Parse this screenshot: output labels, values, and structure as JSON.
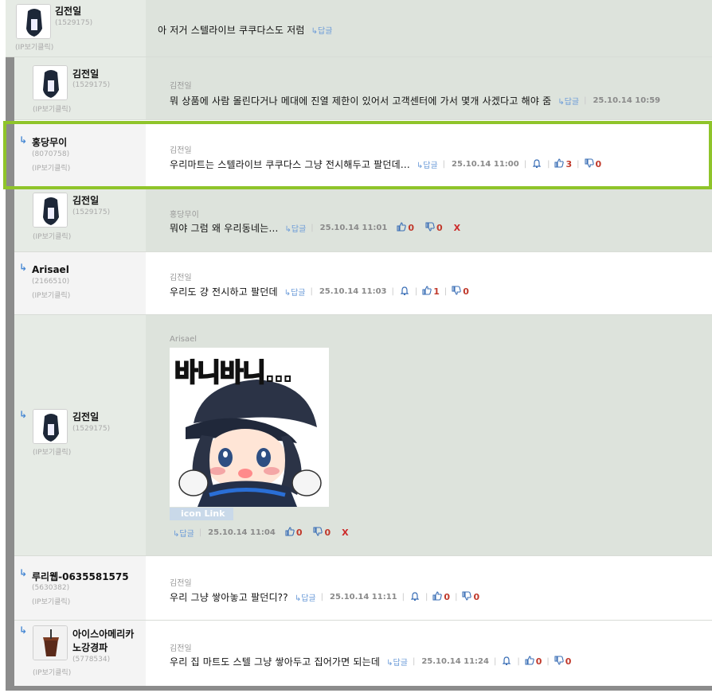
{
  "comments": [
    {
      "nick": "김전일",
      "uid": "(1529175)",
      "ip": "(IP보기클릭)",
      "text": "아 저거 스텔라이브 쿠쿠다스도 저럼",
      "reply_label": "↳답글"
    },
    {
      "nick": "김전일",
      "uid": "(1529175)",
      "ip": "(IP보기클릭)",
      "target": "김전일",
      "text": "뭐 상품에 사람 몰린다거나 메대에 진열 제한이 있어서 고객센터에 가서 몇개 사겠다고 해야 줌",
      "reply_label": "↳답글",
      "date": "25.10.14 10:59"
    },
    {
      "nick": "홍당무이",
      "uid": "(8070758)",
      "ip": "(IP보기클릭)",
      "target": "김전일",
      "text": "우리마트는 스텔라이브 쿠쿠다스 그냥 전시해두고 팔던데...",
      "reply_label": "↳답글",
      "date": "25.10.14 11:00",
      "up": "3",
      "down": "0"
    },
    {
      "nick": "김전일",
      "uid": "(1529175)",
      "ip": "(IP보기클릭)",
      "target": "홍당무이",
      "text": "뭐야 그럼 왜 우리동네는...",
      "reply_label": "↳답글",
      "date": "25.10.14 11:01",
      "up": "0",
      "down": "0",
      "delete": "X"
    },
    {
      "nick": "Arisael",
      "uid": "(2166510)",
      "ip": "(IP보기클릭)",
      "target": "김전일",
      "text": "우리도 걍 전시하고 팔던데",
      "reply_label": "↳답글",
      "date": "25.10.14 11:03",
      "up": "1",
      "down": "0"
    },
    {
      "nick": "김전일",
      "uid": "(1529175)",
      "ip": "(IP보기클릭)",
      "target": "Arisael",
      "sticker_text": "바니바니...",
      "icon_link": "icon Link",
      "reply_label": "↳답글",
      "date": "25.10.14 11:04",
      "up": "0",
      "down": "0",
      "delete": "X"
    },
    {
      "nick": "루리웹-0635581575",
      "uid": "(5630382)",
      "ip": "(IP보기클릭)",
      "target": "김전일",
      "text": "우리 그냥 쌓아놓고 팔던디??",
      "reply_label": "↳답글",
      "date": "25.10.14 11:11",
      "up": "0",
      "down": "0"
    },
    {
      "nick_line1": "아이스아메리카",
      "nick_line2": "노강경파",
      "uid": "(5778534)",
      "ip": "(IP보기클릭)",
      "target": "김전일",
      "text": "우리 집 마트도 스텔 그냥 쌓아두고 집어가면 되는데",
      "reply_label": "↳답글",
      "date": "25.10.14 11:24",
      "up": "0",
      "down": "0"
    }
  ],
  "icons": {
    "reply_arrow": "↳",
    "alarm": "bell-icon",
    "thumbs_up": "thumbs-up-icon",
    "thumbs_down": "thumbs-down-icon"
  },
  "colors": {
    "highlight": "#8fc42a",
    "accent": "#3b6fb6",
    "vote_count": "#c0392b"
  }
}
